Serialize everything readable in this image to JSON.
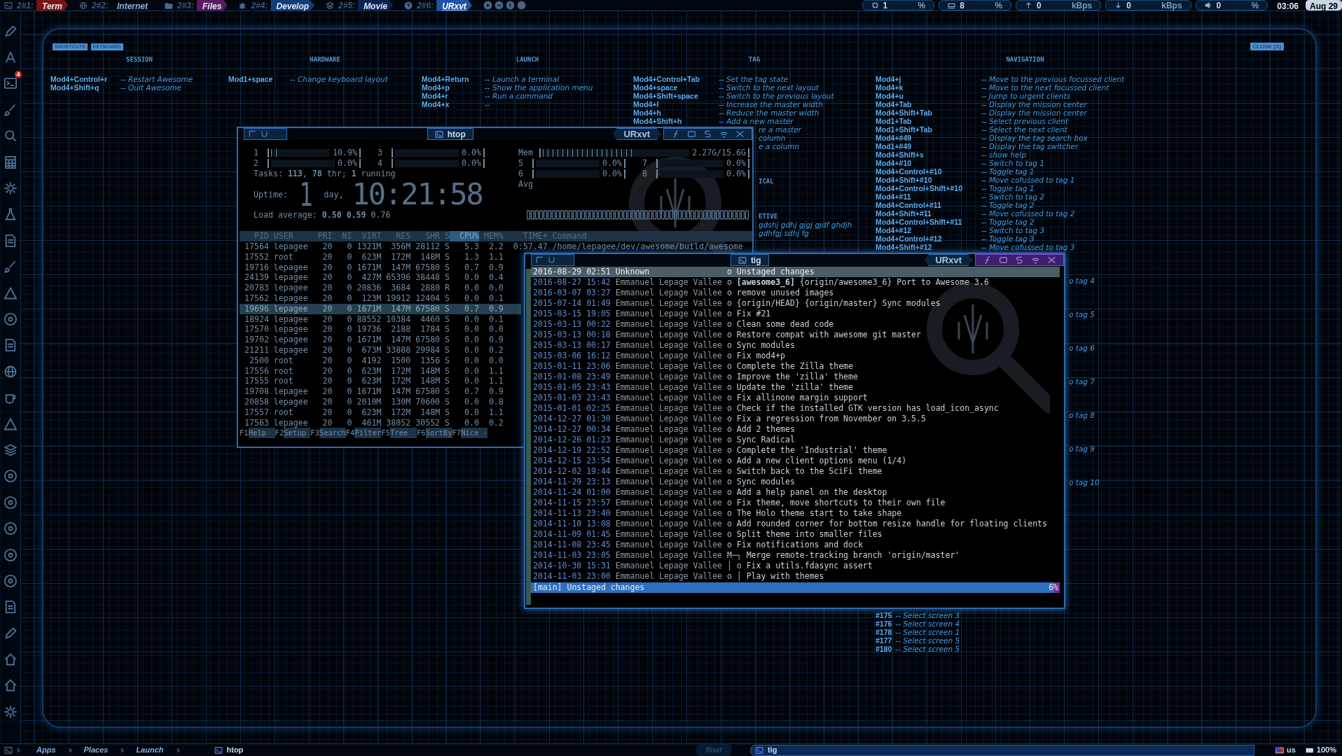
{
  "top_bar": {
    "tags": [
      {
        "number": "2#1:",
        "label": "Term",
        "color": "#7a1212",
        "selected": false
      },
      {
        "number": "2#2:",
        "label": "Internet",
        "selected": false
      },
      {
        "number": "2#3:",
        "label": "Files",
        "color": "#5a1a60",
        "selected": false
      },
      {
        "number": "2#4:",
        "label": "Develop",
        "color": "#123d74",
        "selected": false
      },
      {
        "number": "2#5:",
        "label": "Movie",
        "color": "#0c2352",
        "selected": false
      },
      {
        "number": "2#6:",
        "label": "URxvt",
        "color": "#1f52a8",
        "selected": true
      }
    ],
    "widgets": [
      {
        "value": "1",
        "unit": "%"
      },
      {
        "value": "8",
        "unit": "%"
      },
      {
        "value": "0",
        "unit": "kBps"
      },
      {
        "value": "0",
        "unit": "kBps"
      },
      {
        "value": "0",
        "unit": "%"
      }
    ],
    "clock": "03:06",
    "date": "Aug 29"
  },
  "dock": {
    "badge": "4"
  },
  "help": {
    "buttons": [
      "SHORTCUTS",
      "KEYBOARD"
    ],
    "close": "CLOSE [X]",
    "sections": [
      {
        "title": "SESSION",
        "items": [
          {
            "kind": "entry",
            "key": "Mod4+Control+r",
            "desc": "-- Restart Awesome"
          },
          {
            "kind": "entry",
            "key": "Mod4+Shift+q",
            "desc": "-- Quit Awesome"
          }
        ]
      },
      {
        "title": "HARDWARE",
        "items": [
          {
            "kind": "entry",
            "key": "Mod1+space",
            "desc": "-- Change keyboard layout"
          }
        ]
      },
      {
        "title": "LAUNCH",
        "items": [
          {
            "kind": "entry",
            "key": "Mod4+Return",
            "desc": "-- Launch a terminal"
          },
          {
            "kind": "entry",
            "key": "Mod4+p",
            "desc": "-- Show the application menu"
          },
          {
            "kind": "entry",
            "key": "Mod4+r",
            "desc": "-- Run a command"
          },
          {
            "kind": "entry",
            "key": "Mod4+x",
            "desc": "--"
          }
        ]
      },
      {
        "title": "TAG",
        "items": [
          {
            "kind": "entry",
            "key": "Mod4+Control+Tab",
            "desc": "-- Set the tag state"
          },
          {
            "kind": "entry",
            "key": "Mod4+space",
            "desc": "-- Switch to the next layout"
          },
          {
            "kind": "entry",
            "key": "Mod4+Shift+space",
            "desc": "-- Switch to the previous layout"
          },
          {
            "kind": "entry",
            "key": "Mod4+l",
            "desc": "-- Increase the master width"
          },
          {
            "kind": "entry",
            "key": "Mod4+h",
            "desc": "-- Reduce the master width"
          },
          {
            "kind": "entry",
            "key": "Mod4+Shift+h",
            "desc": "-- Add a new master"
          },
          {
            "kind": "fragment",
            "desc": "re a master"
          },
          {
            "kind": "fragment",
            "desc": "column"
          },
          {
            "kind": "fragment",
            "desc": "e a column"
          },
          {
            "kind": "heading",
            "desc": "ICAL"
          },
          {
            "kind": "heading",
            "desc": "ETIVE"
          },
          {
            "kind": "fragment",
            "desc": "gdshj gdhj gjgj gjdf ghdjh"
          },
          {
            "kind": "fragment",
            "desc": "gdhfgj sdhj fg"
          }
        ]
      },
      {
        "title": "NAVIGATION",
        "items": [
          {
            "kind": "entry",
            "key": "Mod4+j",
            "desc": "-- Move to the previous focussed client"
          },
          {
            "kind": "entry",
            "key": "Mod4+k",
            "desc": "-- Move to the next focussed client"
          },
          {
            "kind": "entry",
            "key": "Mod4+u",
            "desc": "-- Jump to urgent clients"
          },
          {
            "kind": "entry",
            "key": "Mod4+Tab",
            "desc": "-- Display the mission center"
          },
          {
            "kind": "entry",
            "key": "Mod4+Shift+Tab",
            "desc": "-- Display the mission center"
          },
          {
            "kind": "entry",
            "key": "Mod1+Tab",
            "desc": "-- Select previous client"
          },
          {
            "kind": "entry",
            "key": "Mod1+Shift+Tab",
            "desc": "-- Select the next client"
          },
          {
            "kind": "entry",
            "key": "Mod4+#49",
            "desc": "-- Display the tag search box"
          },
          {
            "kind": "entry",
            "key": "Mod1+#49",
            "desc": "-- Display the tag switcher"
          },
          {
            "kind": "entry",
            "key": "Mod4+Shift+s",
            "desc": "-- show help"
          },
          {
            "kind": "entry",
            "key": "Mod4+#10",
            "desc": "-- Switch to tag 1"
          },
          {
            "kind": "entry",
            "key": "Mod4+Control+#10",
            "desc": "-- Toggle tag 1"
          },
          {
            "kind": "entry",
            "key": "Mod4+Shift+#10",
            "desc": "-- Move cofussed to tag 1"
          },
          {
            "kind": "entry",
            "key": "Mod4+Control+Shift+#10",
            "desc": "-- Toggle tag 1"
          },
          {
            "kind": "entry",
            "key": "Mod4+#11",
            "desc": "-- Switch to tag 2"
          },
          {
            "kind": "entry",
            "key": "Mod4+Control+#11",
            "desc": "-- Toggle tag 2"
          },
          {
            "kind": "entry",
            "key": "Mod4+Shift+#11",
            "desc": "-- Move cofussed to tag 2"
          },
          {
            "kind": "entry",
            "key": "Mod4+Control+Shift+#11",
            "desc": "-- Toggle tag 2"
          },
          {
            "kind": "entry",
            "key": "Mod4+#12",
            "desc": "-- Switch to tag 3"
          },
          {
            "kind": "entry",
            "key": "Mod4+Control+#12",
            "desc": "-- Toggle tag 3"
          },
          {
            "kind": "entry",
            "key": "Mod4+Shift+#12",
            "desc": "-- Move cofussed to tag 3"
          },
          {
            "kind": "fragment",
            "desc": "o tag 4"
          },
          {
            "kind": "fragment",
            "desc": "o tag 5"
          },
          {
            "kind": "fragment",
            "desc": "o tag 6"
          },
          {
            "kind": "fragment",
            "desc": "o tag 7"
          },
          {
            "kind": "fragment",
            "desc": "o tag 8"
          },
          {
            "kind": "fragment",
            "desc": "o tag 9"
          },
          {
            "kind": "fragment",
            "desc": "o tag 10"
          },
          {
            "kind": "screen",
            "key": "#175",
            "desc": "-- Select screen 3"
          },
          {
            "kind": "screen",
            "key": "#176",
            "desc": "-- Select screen 4"
          },
          {
            "kind": "screen",
            "key": "#178",
            "desc": "-- Select screen 1"
          },
          {
            "kind": "screen",
            "key": "#177",
            "desc": "-- Select screen 5"
          },
          {
            "kind": "screen",
            "key": "#180",
            "desc": "-- Select screen 5"
          }
        ]
      }
    ]
  },
  "htop_window": {
    "title": "htop",
    "app": "URxvt",
    "focused": false,
    "cpu_meters": [
      {
        "label": "1",
        "level": 0.12,
        "reading": "10.9%"
      },
      {
        "label": "3",
        "level": 0,
        "reading": "0.0%"
      },
      {
        "label": "2",
        "level": 0,
        "reading": "0.0%"
      },
      {
        "label": "4",
        "level": 0,
        "reading": "0.0%"
      },
      {
        "label": "5",
        "level": 0,
        "reading": "0.0%"
      },
      {
        "label": "7",
        "level": 0,
        "reading": "0.0%"
      },
      {
        "label": "6",
        "level": 0,
        "reading": "0.0%"
      },
      {
        "label": "8",
        "level": 0,
        "reading": "0.0%"
      }
    ],
    "memory": {
      "label": "Mem",
      "level": 0.62,
      "reading": "2.27G/15.6G"
    },
    "avg_label": "Avg",
    "tasks": "Tasks: **113**, **78** thr; **1** running",
    "uptime": {
      "label": "Uptime:",
      "days": "1",
      "days_label": "day,",
      "time": "10:21:58"
    },
    "load": "Load average: **0.50** **0.59** 0.76",
    "columns": [
      "PID",
      "USER",
      "PRI",
      "NI",
      "VIRT",
      "RES",
      "SHR",
      "S",
      "CPU%",
      "MEM%",
      "TIME+",
      "Command"
    ],
    "rows": [
      {
        "selected": false,
        "cells": [
          "17564",
          "lepagee",
          "20",
          "0",
          "1321M",
          "356M",
          "28112",
          "S",
          "5.3",
          "2.2",
          "0:57.47",
          "/home/lepagee/dev/awesome/build/awesome"
        ]
      },
      {
        "selected": false,
        "cells": [
          "17552",
          "root",
          "20",
          "0",
          "623M",
          "172M",
          "148M",
          "S",
          "1.3",
          "1.1"
        ]
      },
      {
        "selected": false,
        "cells": [
          "19716",
          "lepagee",
          "20",
          "0",
          "1671M",
          "147M",
          "67580",
          "S",
          "0.7",
          "0.9"
        ]
      },
      {
        "selected": false,
        "cells": [
          "24139",
          "lepagee",
          "20",
          "0",
          "427M",
          "65396",
          "38448",
          "S",
          "0.0",
          "0.4"
        ]
      },
      {
        "selected": false,
        "cells": [
          "20783",
          "lepagee",
          "20",
          "0",
          "20836",
          "3684",
          "2880",
          "R",
          "0.0",
          "0.0"
        ]
      },
      {
        "selected": false,
        "cells": [
          "17562",
          "lepagee",
          "20",
          "0",
          "123M",
          "19912",
          "12404",
          "S",
          "0.0",
          "0.1"
        ]
      },
      {
        "selected": true,
        "cells": [
          "19696",
          "lepagee",
          "20",
          "0",
          "1671M",
          "147M",
          "67580",
          "S",
          "0.7",
          "0.9"
        ]
      },
      {
        "selected": false,
        "cells": [
          "18924",
          "lepagee",
          "20",
          "0",
          "88552",
          "10384",
          "4460",
          "S",
          "0.0",
          "0.1"
        ]
      },
      {
        "selected": false,
        "cells": [
          "17570",
          "lepagee",
          "20",
          "0",
          "19736",
          "2188",
          "1784",
          "S",
          "0.0",
          "0.0"
        ]
      },
      {
        "selected": false,
        "cells": [
          "19702",
          "lepagee",
          "20",
          "0",
          "1671M",
          "147M",
          "67580",
          "S",
          "0.0",
          "0.9"
        ]
      },
      {
        "selected": false,
        "cells": [
          "21211",
          "lepagee",
          "20",
          "0",
          "673M",
          "33888",
          "29984",
          "S",
          "0.0",
          "0.2"
        ]
      },
      {
        "selected": false,
        "cells": [
          "2500",
          "root",
          "20",
          "0",
          "4192",
          "1500",
          "1356",
          "S",
          "0.0",
          "0.0"
        ]
      },
      {
        "selected": false,
        "cells": [
          "17556",
          "root",
          "20",
          "0",
          "623M",
          "172M",
          "148M",
          "S",
          "0.0",
          "1.1"
        ]
      },
      {
        "selected": false,
        "cells": [
          "17555",
          "root",
          "20",
          "0",
          "623M",
          "172M",
          "148M",
          "S",
          "0.0",
          "1.1"
        ]
      },
      {
        "selected": false,
        "cells": [
          "19708",
          "lepagee",
          "20",
          "0",
          "1671M",
          "147M",
          "67580",
          "S",
          "0.7",
          "0.9"
        ]
      },
      {
        "selected": false,
        "cells": [
          "20858",
          "lepagee",
          "20",
          "0",
          "2010M",
          "130M",
          "70600",
          "S",
          "0.0",
          "0.8"
        ]
      },
      {
        "selected": false,
        "cells": [
          "17557",
          "root",
          "20",
          "0",
          "623M",
          "172M",
          "148M",
          "S",
          "0.0",
          "1.1"
        ]
      },
      {
        "selected": false,
        "cells": [
          "17563",
          "lepagee",
          "20",
          "0",
          "461M",
          "38052",
          "30552",
          "S",
          "0.0",
          "0.2"
        ]
      }
    ],
    "function_keys": [
      {
        "key": "F1",
        "label": "Help"
      },
      {
        "key": "F2",
        "label": "Setup"
      },
      {
        "key": "F3",
        "label": "Search"
      },
      {
        "key": "F4",
        "label": "Filter"
      },
      {
        "key": "F5",
        "label": "Tree"
      },
      {
        "key": "F6",
        "label": "SortBy"
      },
      {
        "key": "F7",
        "label": "Nice -"
      }
    ]
  },
  "tig_window": {
    "title": "tig",
    "app": "URxvt",
    "focused": true,
    "commits": [
      {
        "selected": true,
        "date": "2016-08-29 02:51",
        "author": "Unknown",
        "graph": "o",
        "message": "Unstaged changes"
      },
      {
        "selected": false,
        "date": "2016-08-27 15:42",
        "author": "Emmanuel Lepage Vallee",
        "graph": "o",
        "message": "**[awesome3_6]** {origin/awesome3_6} Port to Awesome 3.6"
      },
      {
        "selected": false,
        "date": "2016-03-07 03:27",
        "author": "Emmanuel Lepage Vallee",
        "graph": "o",
        "message": "remove unused images"
      },
      {
        "selected": false,
        "date": "2015-07-14 01:49",
        "author": "Emmanuel Lepage Vallee",
        "graph": "o",
        "message": "{origin/HEAD} {origin/master} Sync modules"
      },
      {
        "selected": false,
        "date": "2015-03-15 19:05",
        "author": "Emmanuel Lepage Vallee",
        "graph": "o",
        "message": "Fix #21"
      },
      {
        "selected": false,
        "date": "2015-03-13 00:22",
        "author": "Emmanuel Lepage Vallee",
        "graph": "o",
        "message": "Clean some dead code"
      },
      {
        "selected": false,
        "date": "2015-03-13 00:18",
        "author": "Emmanuel Lepage Vallee",
        "graph": "o",
        "message": "Restore compat with awesome git master"
      },
      {
        "selected": false,
        "date": "2015-03-13 00:17",
        "author": "Emmanuel Lepage Vallee",
        "graph": "o",
        "message": "Sync modules"
      },
      {
        "selected": false,
        "date": "2015-03-06 16:12",
        "author": "Emmanuel Lepage Vallee",
        "graph": "o",
        "message": "Fix mod4+p"
      },
      {
        "selected": false,
        "date": "2015-01-11 23:06",
        "author": "Emmanuel Lepage Vallee",
        "graph": "o",
        "message": "Complete the Zilla theme"
      },
      {
        "selected": false,
        "date": "2015-01-08 23:49",
        "author": "Emmanuel Lepage Vallee",
        "graph": "o",
        "message": "Improve the 'zilla' theme"
      },
      {
        "selected": false,
        "date": "2015-01-05 23:43",
        "author": "Emmanuel Lepage Vallee",
        "graph": "o",
        "message": "Update the 'zilla' theme"
      },
      {
        "selected": false,
        "date": "2015-01-03 23:43",
        "author": "Emmanuel Lepage Vallee",
        "graph": "o",
        "message": "Fix allinone margin support"
      },
      {
        "selected": false,
        "date": "2015-01-01 02:25",
        "author": "Emmanuel Lepage Vallee",
        "graph": "o",
        "message": "Check if the installed GTK version has load_icon_async"
      },
      {
        "selected": false,
        "date": "2014-12-27 01:30",
        "author": "Emmanuel Lepage Vallee",
        "graph": "o",
        "message": "Fix a regression from November on 3.5.5"
      },
      {
        "selected": false,
        "date": "2014-12-27 00:34",
        "author": "Emmanuel Lepage Vallee",
        "graph": "o",
        "message": "Add 2 themes"
      },
      {
        "selected": false,
        "date": "2014-12-26 01:23",
        "author": "Emmanuel Lepage Vallee",
        "graph": "o",
        "message": "Sync Radical"
      },
      {
        "selected": false,
        "date": "2014-12-19 22:52",
        "author": "Emmanuel Lepage Vallee",
        "graph": "o",
        "message": "Complete the 'Industrial' theme"
      },
      {
        "selected": false,
        "date": "2014-12-15 23:54",
        "author": "Emmanuel Lepage Vallee",
        "graph": "o",
        "message": "Add a new client options menu (1/4)"
      },
      {
        "selected": false,
        "date": "2014-12-02 19:44",
        "author": "Emmanuel Lepage Vallee",
        "graph": "o",
        "message": "Switch back to the SciFi theme"
      },
      {
        "selected": false,
        "date": "2014-11-29 23:13",
        "author": "Emmanuel Lepage Vallee",
        "graph": "o",
        "message": "Sync modules"
      },
      {
        "selected": false,
        "date": "2014-11-24 01:00",
        "author": "Emmanuel Lepage Vallee",
        "graph": "o",
        "message": "Add a help panel on the desktop"
      },
      {
        "selected": false,
        "date": "2014-11-15 23:57",
        "author": "Emmanuel Lepage Vallee",
        "graph": "o",
        "message": "Fix theme, move shortcuts to their own file"
      },
      {
        "selected": false,
        "date": "2014-11-13 23:40",
        "author": "Emmanuel Lepage Vallee",
        "graph": "o",
        "message": "The Holo theme start to take shape"
      },
      {
        "selected": false,
        "date": "2014-11-10 13:08",
        "author": "Emmanuel Lepage Vallee",
        "graph": "o",
        "message": "Add rounded corner for bottom resize handle for floating clients"
      },
      {
        "selected": false,
        "date": "2014-11-09 01:45",
        "author": "Emmanuel Lepage Vallee",
        "graph": "o",
        "message": "Split theme into smaller files"
      },
      {
        "selected": false,
        "date": "2014-11-08 23:45",
        "author": "Emmanuel Lepage Vallee",
        "graph": "o",
        "message": "Fix notifications and dock"
      },
      {
        "selected": false,
        "date": "2014-11-03 23:05",
        "author": "Emmanuel Lepage Vallee",
        "graph": "M─┐",
        "message": "Merge remote-tracking branch 'origin/master'"
      },
      {
        "selected": false,
        "date": "2014-10-30 15:31",
        "author": "Emmanuel Lepage Vallee",
        "graph": "│ o",
        "message": "Fix a utils.fdasync assert"
      },
      {
        "selected": false,
        "date": "2014-11-03 23:00",
        "author": "Emmanuel Lepage Vallee",
        "graph": "o │",
        "message": "Play with themes"
      }
    ],
    "status": "[main] Unstaged changes",
    "percent": "6%"
  },
  "bottom_bar": {
    "launchers": [
      "Apps",
      "Places",
      "Launch"
    ],
    "tasks": [
      {
        "label": "htop",
        "selected": false
      },
      {
        "label": "tig",
        "selected": true
      }
    ],
    "layout": "float",
    "keyboard": "us",
    "battery": "100%"
  }
}
